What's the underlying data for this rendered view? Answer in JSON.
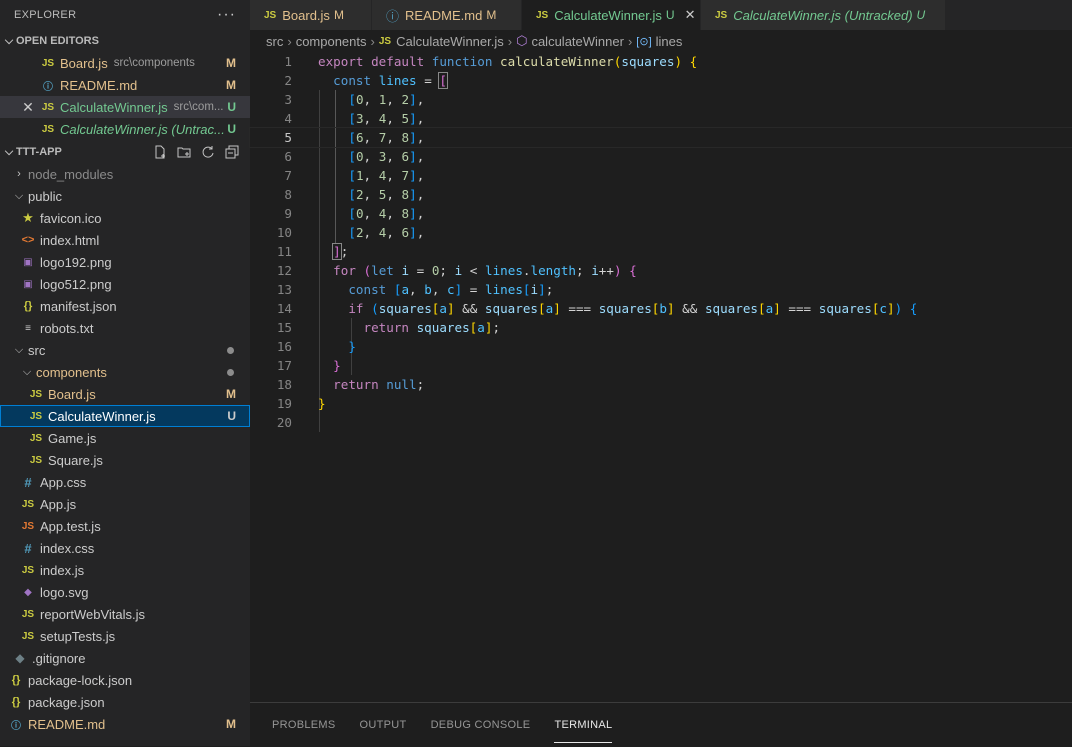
{
  "explorer": {
    "title": "EXPLORER",
    "more_label": "···",
    "open_editors_title": "OPEN EDITORS",
    "open_editors": [
      {
        "icon": "JS",
        "label": "Board.js",
        "desc": "src\\components",
        "status": "M"
      },
      {
        "icon": "i",
        "label": "README.md",
        "desc": "",
        "status": "M"
      },
      {
        "icon": "JS",
        "label": "CalculateWinner.js",
        "desc": "src\\com...",
        "status": "U"
      },
      {
        "icon": "JS",
        "label": "CalculateWinner.js (Untrac...",
        "desc": "",
        "status": "U"
      }
    ],
    "project_title": "TTT-APP",
    "tree": {
      "node_modules": "node_modules",
      "public": "public",
      "favicon": "favicon.ico",
      "index_html": "index.html",
      "logo192": "logo192.png",
      "logo512": "logo512.png",
      "manifest": "manifest.json",
      "robots": "robots.txt",
      "src": "src",
      "components": "components",
      "board": "Board.js",
      "board_status": "M",
      "calc": "CalculateWinner.js",
      "calc_status": "U",
      "game": "Game.js",
      "square": "Square.js",
      "app_css": "App.css",
      "app_js": "App.js",
      "app_test": "App.test.js",
      "index_css": "index.css",
      "index_js": "index.js",
      "logo_svg": "logo.svg",
      "report": "reportWebVitals.js",
      "setup": "setupTests.js",
      "gitignore": ".gitignore",
      "pkg_lock": "package-lock.json",
      "pkg": "package.json",
      "readme": "README.md",
      "readme_status": "M"
    }
  },
  "tabs": [
    {
      "icon": "JS",
      "label": "Board.js",
      "status": "M"
    },
    {
      "icon": "i",
      "label": "README.md",
      "status": "M"
    },
    {
      "icon": "JS",
      "label": "CalculateWinner.js",
      "status": "U"
    },
    {
      "icon": "JS",
      "label": "CalculateWinner.js (Untracked)",
      "status": "U"
    }
  ],
  "breadcrumb": {
    "src": "src",
    "components": "components",
    "file": "CalculateWinner.js",
    "func": "calculateWinner",
    "var": "lines"
  },
  "editor": {
    "line_numbers": [
      "1",
      "2",
      "3",
      "4",
      "5",
      "6",
      "7",
      "8",
      "9",
      "10",
      "11",
      "12",
      "13",
      "14",
      "15",
      "16",
      "17",
      "18",
      "19",
      "20"
    ],
    "current_line": "5"
  },
  "panel": {
    "tabs": [
      "PROBLEMS",
      "OUTPUT",
      "DEBUG CONSOLE",
      "TERMINAL"
    ],
    "active": "TERMINAL"
  },
  "colors": {
    "modified": "#e2c08d",
    "untracked": "#73c991",
    "selection": "#04395e",
    "editor_bg": "#1e1e1e",
    "sidebar_bg": "#252526"
  }
}
